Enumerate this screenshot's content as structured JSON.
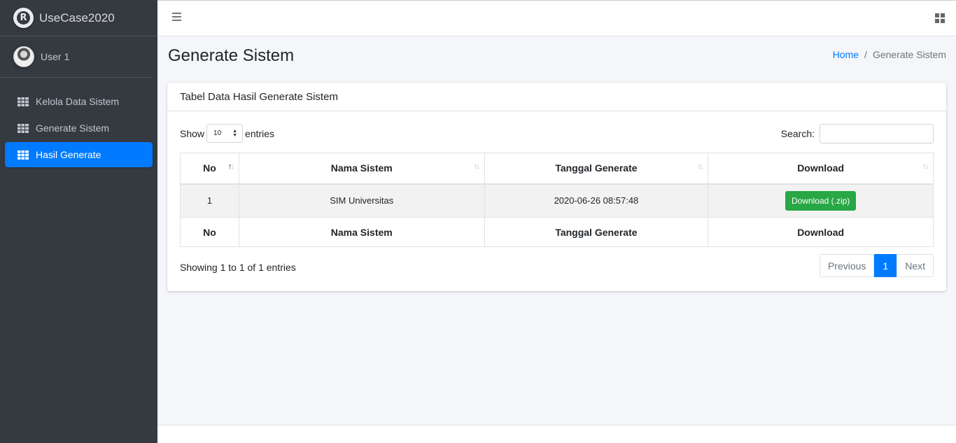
{
  "brand": {
    "name": "UseCase2020"
  },
  "user": {
    "name": "User 1"
  },
  "sidebar": {
    "items": [
      {
        "label": "Kelola Data Sistem",
        "icon": "grid-icon",
        "active": false
      },
      {
        "label": "Generate Sistem",
        "icon": "grid-icon",
        "active": false
      },
      {
        "label": "Hasil Generate",
        "icon": "grid-icon",
        "active": true
      }
    ]
  },
  "page": {
    "title": "Generate Sistem",
    "breadcrumb": {
      "home": "Home",
      "separator": "/",
      "current": "Generate Sistem"
    }
  },
  "card": {
    "title": "Tabel Data Hasil Generate Sistem",
    "length": {
      "show": "Show",
      "value": "10",
      "entries": "entries"
    },
    "search": {
      "label": "Search:",
      "value": ""
    },
    "table": {
      "headers": [
        "No",
        "Nama Sistem",
        "Tanggal Generate",
        "Download"
      ],
      "rows": [
        {
          "no": "1",
          "nama": "SIM Universitas",
          "tanggal": "2020-06-26 08:57:48",
          "download": "Download (.zip)"
        }
      ],
      "footers": [
        "No",
        "Nama Sistem",
        "Tanggal Generate",
        "Download"
      ]
    },
    "info": "Showing 1 to 1 of 1 entries",
    "pagination": {
      "previous": "Previous",
      "current": "1",
      "next": "Next"
    }
  },
  "colors": {
    "primary": "#007bff",
    "success": "#28a745",
    "sidebar": "#343a40"
  }
}
